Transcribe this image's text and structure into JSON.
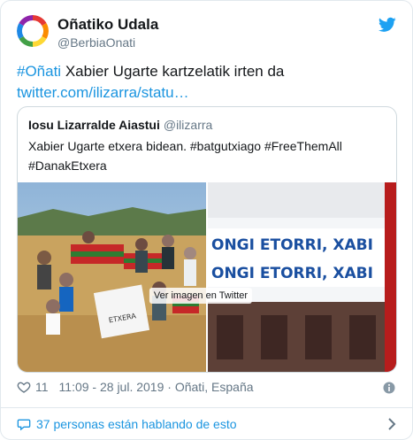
{
  "colors": {
    "link": "#1b95e0",
    "text": "#14171a",
    "secondary": "#657786",
    "border": "#e1e8ed"
  },
  "author": {
    "display_name": "Oñatiko Udala",
    "handle": "@BerbiaOnati",
    "avatar_icon": "colorful-ring-logo"
  },
  "tweet": {
    "hashtag": "#Oñati",
    "text": " Xabier Ugarte kartzelatik irten da ",
    "link": "twitter.com/ilizarra/statu…"
  },
  "quote": {
    "name": "Iosu Lizarralde Aiastui",
    "handle": "@ilizarra",
    "text": "Xabier Ugarte etxera bidean. #batgutxiago #FreeThemAll #DanakEtxera",
    "image_label": "Ver imagen en Twitter",
    "banner_line1": "ONGI ETORRI, XABI",
    "banner_line2": "ONGI ETORRI, XABI",
    "sign_text": "ETXERA"
  },
  "meta": {
    "likes": "11",
    "timestamp": "11:09 - 28 jul. 2019 · Oñati, España"
  },
  "footer": {
    "conversation": "37 personas están hablando de esto"
  }
}
